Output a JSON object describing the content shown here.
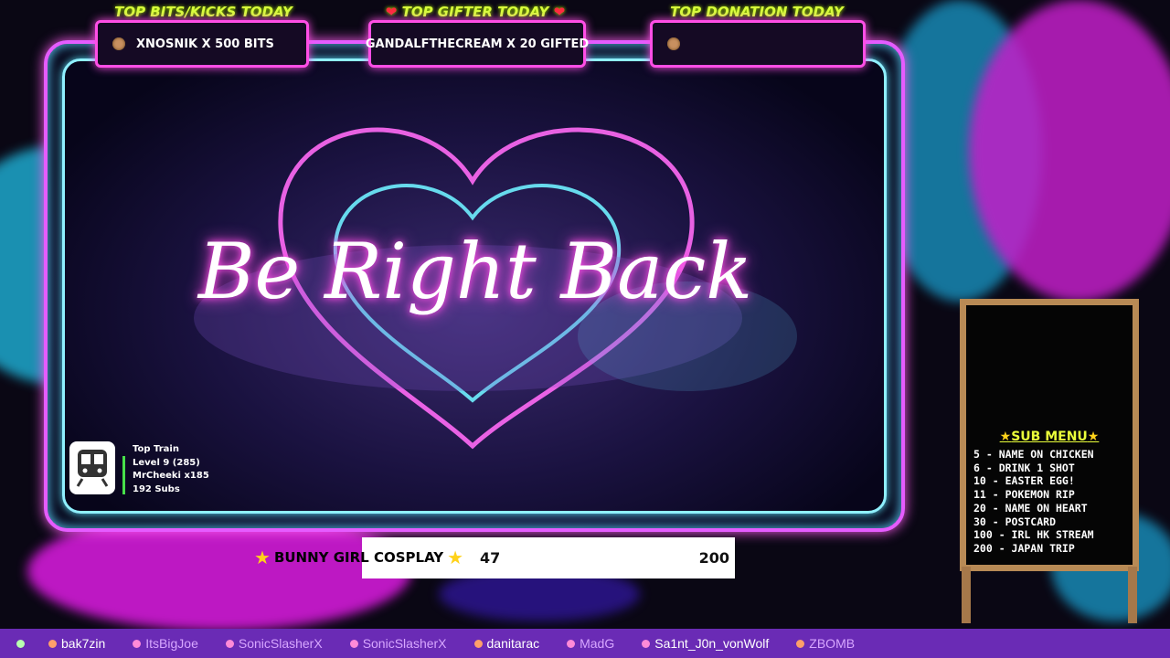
{
  "top_panels": [
    {
      "title": "TOP BITS/KICKS TODAY",
      "value": "XNOSNIK X 500 BITS",
      "icon": "heart-coin-icon"
    },
    {
      "title": "TOP GIFTER TODAY",
      "value": "GANDALFTHECREAM X 20 GIFTED",
      "icon": "heart-icon"
    },
    {
      "title": "TOP DONATION TODAY",
      "value": "",
      "icon": "heart-coin-icon"
    }
  ],
  "main": {
    "headline": "Be Right Back"
  },
  "train": {
    "title": "Top Train",
    "level": "Level 9  (285)",
    "top_user": "MrCheeki x185",
    "subs": "192 Subs"
  },
  "goal": {
    "label": "BUNNY GIRL COSPLAY",
    "current": "47",
    "target": "200",
    "progress_fraction": 0.235
  },
  "sub_menu": {
    "title": "SUB MENU",
    "items": [
      "5 - NAME ON CHICKEN",
      "6 - DRINK 1 SHOT",
      "10 - EASTER EGG!",
      "11 - POKEMON RIP",
      "20 - NAME ON HEART",
      "30 - POSTCARD",
      "100 - IRL HK STREAM",
      "200 - JAPAN TRIP"
    ]
  },
  "ticker": [
    {
      "name": "bak7zin",
      "dim": false
    },
    {
      "name": "ItsBigJoe",
      "dim": true
    },
    {
      "name": "SonicSlasherX",
      "dim": true
    },
    {
      "name": "SonicSlasherX",
      "dim": true
    },
    {
      "name": "danitarac",
      "dim": false
    },
    {
      "name": "MadG",
      "dim": true
    },
    {
      "name": "Sa1nt_J0n_vonWolf",
      "dim": false
    },
    {
      "name": "ZBOMB",
      "dim": true
    }
  ],
  "colors": {
    "neon_pink": "#ff4ee6",
    "neon_cyan": "#5ce8ff",
    "title_yellow": "#d8ff3a",
    "ticker_bg": "#6a2bb5",
    "board_frame": "#b88a55"
  }
}
